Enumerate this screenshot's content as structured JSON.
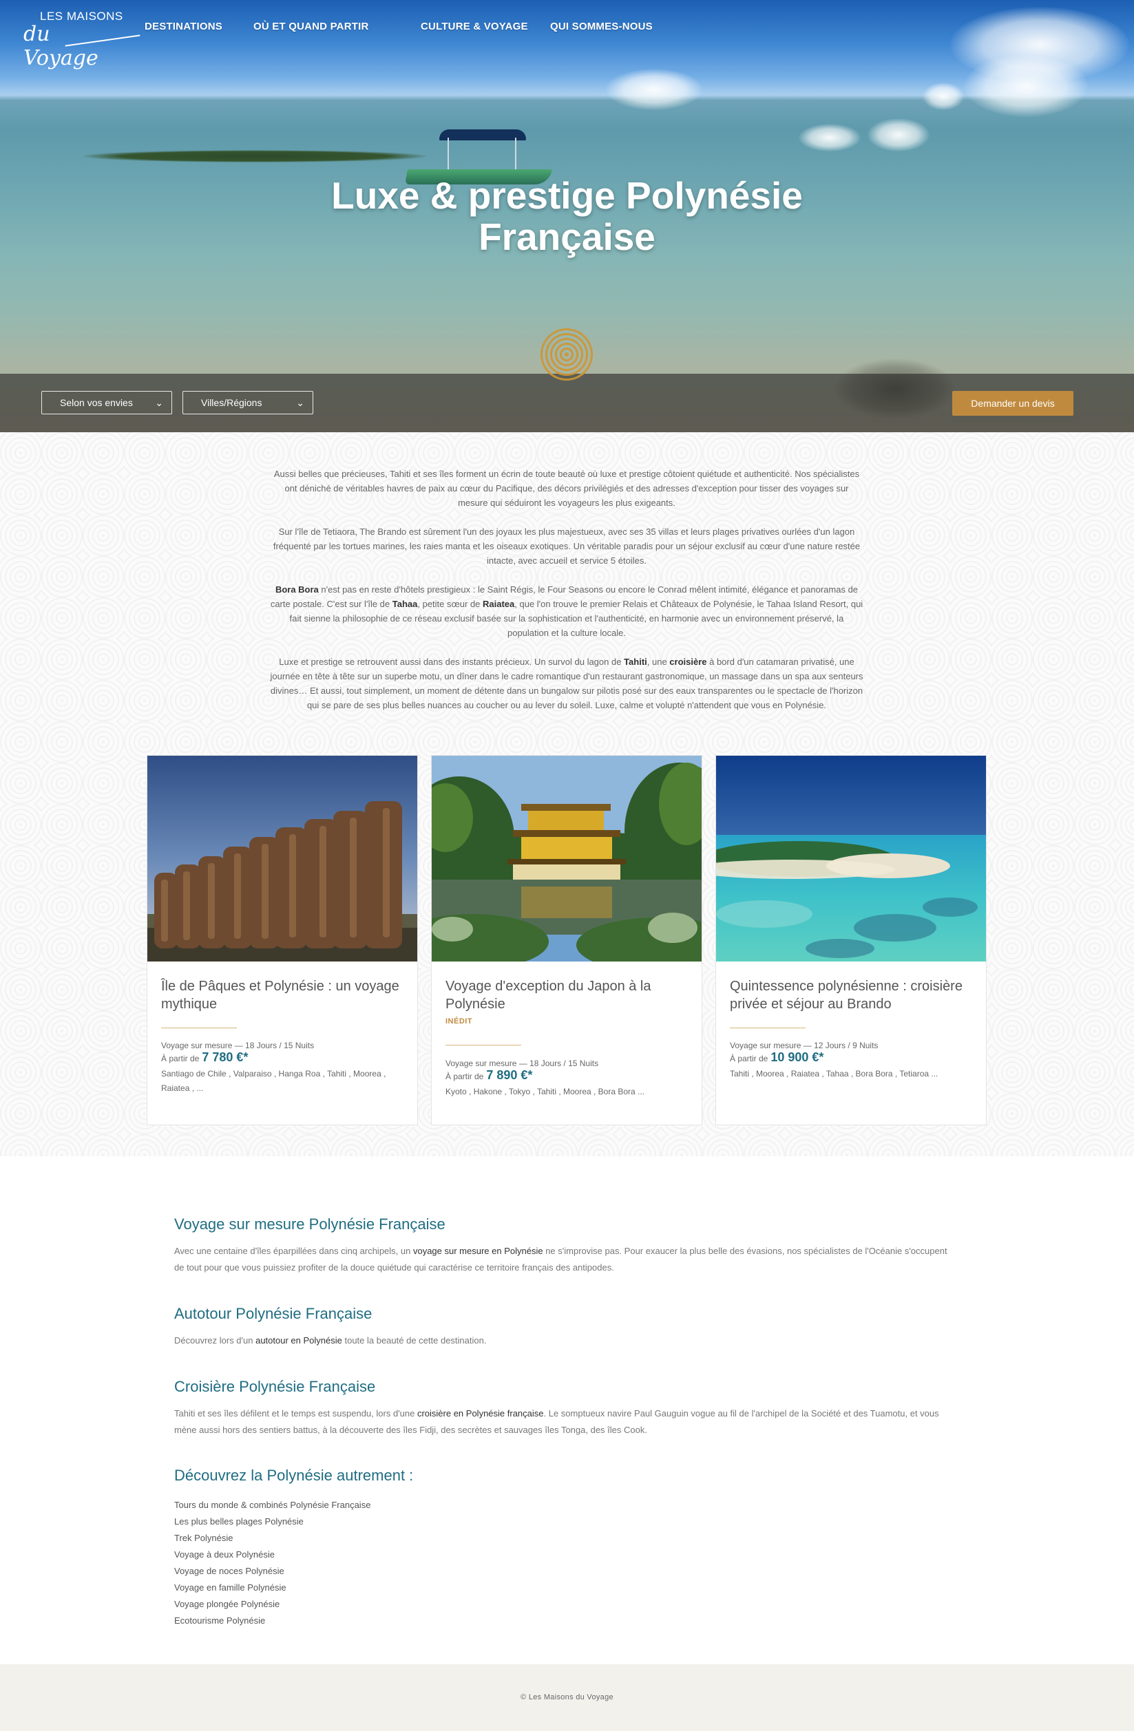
{
  "header": {
    "logo_top": "LES MAISONS",
    "logo_bottom": "du Voyage",
    "nav": [
      "DESTINATIONS",
      "OÙ ET QUAND PARTIR",
      "CULTURE & VOYAGE",
      "QUI SOMMES-NOUS"
    ]
  },
  "hero": {
    "title_line1": "Luxe & prestige Polynésie",
    "title_line2": "Française"
  },
  "filters": {
    "envies": "Selon vos envies",
    "regions": "Villes/Régions",
    "devis_button": "Demander un devis"
  },
  "intro": {
    "p1": "Aussi belles que précieuses, Tahiti et ses îles forment un écrin de toute beauté où luxe et prestige côtoient quiétude et authenticité. Nos spécialistes ont déniché de véritables havres de paix au cœur du Pacifique, des décors privilégiés et des adresses d'exception pour tisser des voyages sur mesure qui séduiront les voyageurs les plus exigeants.",
    "p2": "Sur l'île de Tetiaora, The Brando est sûrement l'un des joyaux les plus majestueux, avec ses 35 villas et leurs plages privatives ourlées d'un lagon fréquenté par les tortues marines, les raies manta et les oiseaux exotiques. Un véritable paradis pour un séjour exclusif au cœur d'une nature restée intacte, avec accueil et service 5 étoiles.",
    "p3_bold1": "Bora Bora",
    "p3_a": " n'est pas en reste d'hôtels prestigieux : le Saint Régis, le Four Seasons ou encore le Conrad mêlent intimité, élégance et panoramas de carte postale. C'est sur l'île de ",
    "p3_bold2": "Tahaa",
    "p3_b": ", petite sœur de ",
    "p3_bold3": "Raiatea",
    "p3_c": ", que l'on trouve le premier Relais et Châteaux de Polynésie, le Tahaa Island Resort, qui fait sienne la philosophie de ce réseau exclusif basée sur la sophistication et l'authenticité, en harmonie avec un environnement préservé, la population et la culture locale.",
    "p4_a": "Luxe et prestige se retrouvent aussi dans des instants précieux. Un survol du lagon de ",
    "p4_bold1": "Tahiti",
    "p4_b": ", une ",
    "p4_bold2": "croisière",
    "p4_c": " à bord d'un catamaran privatisé, une journée en tête à tête sur un superbe motu, un dîner dans le cadre romantique d'un restaurant gastronomique, un massage dans un spa aux senteurs divines… Et aussi, tout simplement, un moment de détente dans un bungalow sur pilotis posé sur des eaux transparentes ou le spectacle de l'horizon qui se pare de ses plus belles nuances au coucher ou au lever du soleil. Luxe, calme et volupté n'attendent que vous en Polynésie."
  },
  "cards": [
    {
      "title": "Île de Pâques et Polynésie : un voyage mythique",
      "badge": "",
      "meta": "Voyage sur mesure  —  18 Jours / 15 Nuits",
      "price_prefix": "À partir de",
      "price": "7 780 €*",
      "places": "Santiago de Chile , Valparaiso , Hanga Roa , Tahiti , Moorea , Raiatea , ..."
    },
    {
      "title": "Voyage d'exception du Japon à la Polynésie",
      "badge": "INÉDIT",
      "meta": "Voyage sur mesure  —  18 Jours / 15 Nuits",
      "price_prefix": "À partir de",
      "price": "7 890 €*",
      "places": "Kyoto , Hakone , Tokyo , Tahiti , Moorea , Bora Bora ..."
    },
    {
      "title": "Quintessence polynésienne : croisière privée et séjour au Brando",
      "badge": "",
      "meta": "Voyage sur mesure  —  12 Jours / 9 Nuits",
      "price_prefix": "À partir de",
      "price": "10 900 €*",
      "places": "Tahiti , Moorea , Raiatea , Tahaa , Bora Bora , Tetiaroa ..."
    }
  ],
  "seo": {
    "s1_title": "Voyage sur mesure Polynésie Française",
    "s1_a": "Avec une centaine d'îles éparpillées dans cinq archipels, un ",
    "s1_link": "voyage sur mesure en Polynésie",
    "s1_b": " ne s'improvise pas. Pour exaucer la plus belle des évasions, nos spécialistes de l'Océanie s'occupent de tout pour que vous puissiez profiter de la douce quiétude qui caractérise ce territoire français des antipodes.",
    "s2_title": "Autotour Polynésie Française",
    "s2_a": "Découvrez  lors d'un ",
    "s2_link": "autotour en Polynésie",
    "s2_b": " toute la beauté de cette destination.",
    "s3_title": "Croisière Polynésie Française",
    "s3_a": "Tahiti et ses îles défilent et le temps est suspendu, lors d'une ",
    "s3_link": "croisière en Polynésie française",
    "s3_b": ". Le somptueux navire Paul Gauguin vogue au fil de l'archipel de la Société et des Tuamotu, et vous mène aussi hors des sentiers battus, à la découverte des îles Fidji, des secrètes et sauvages îles Tonga, des îles Cook.",
    "s4_title": "Découvrez la Polynésie autrement :",
    "links": [
      "Tours du monde & combinés Polynésie Française",
      "Les plus belles plages Polynésie",
      "Trek Polynésie",
      "Voyage à deux Polynésie",
      "Voyage de noces Polynésie",
      "Voyage en famille Polynésie",
      "Voyage plongée Polynésie",
      "Ecotourisme Polynésie"
    ]
  },
  "footer": {
    "copyright": "© Les Maisons du Voyage"
  },
  "colors": {
    "accent_gold": "#c08a3e",
    "teal_heading": "#1f6d82",
    "footer_bg": "#f3f1ec"
  }
}
